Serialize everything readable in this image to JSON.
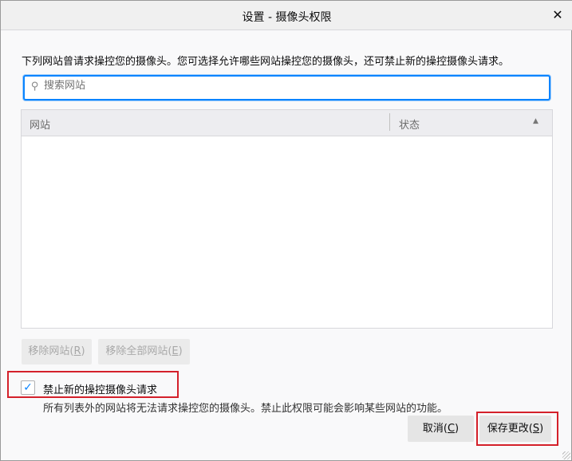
{
  "window": {
    "title": "设置 - 摄像头权限",
    "close_label": "✕"
  },
  "description": "下列网站曾请求操控您的摄像头。您可选择允许哪些网站操控您的摄像头，还可禁止新的操控摄像头请求。",
  "search": {
    "placeholder": "搜索网站",
    "value": "",
    "icon": "search-icon"
  },
  "table": {
    "columns": [
      "网站",
      "状态"
    ],
    "sort_indicator": "▲",
    "rows": []
  },
  "buttons": {
    "remove_site": {
      "text": "移除网站(",
      "key": "R",
      "end": ")"
    },
    "remove_all": {
      "text": "移除全部网站(",
      "key": "E",
      "end": ")"
    },
    "cancel": {
      "text": "取消(",
      "key": "C",
      "end": ")"
    },
    "save": {
      "text": "保存更改(",
      "key": "S",
      "end": ")"
    }
  },
  "block_new": {
    "checked": true,
    "check_mark": "✓",
    "label": "禁止新的操控摄像头请求",
    "hint": "所有列表外的网站将无法请求操控您的摄像头。禁止此权限可能会影响某些网站的功能。"
  }
}
